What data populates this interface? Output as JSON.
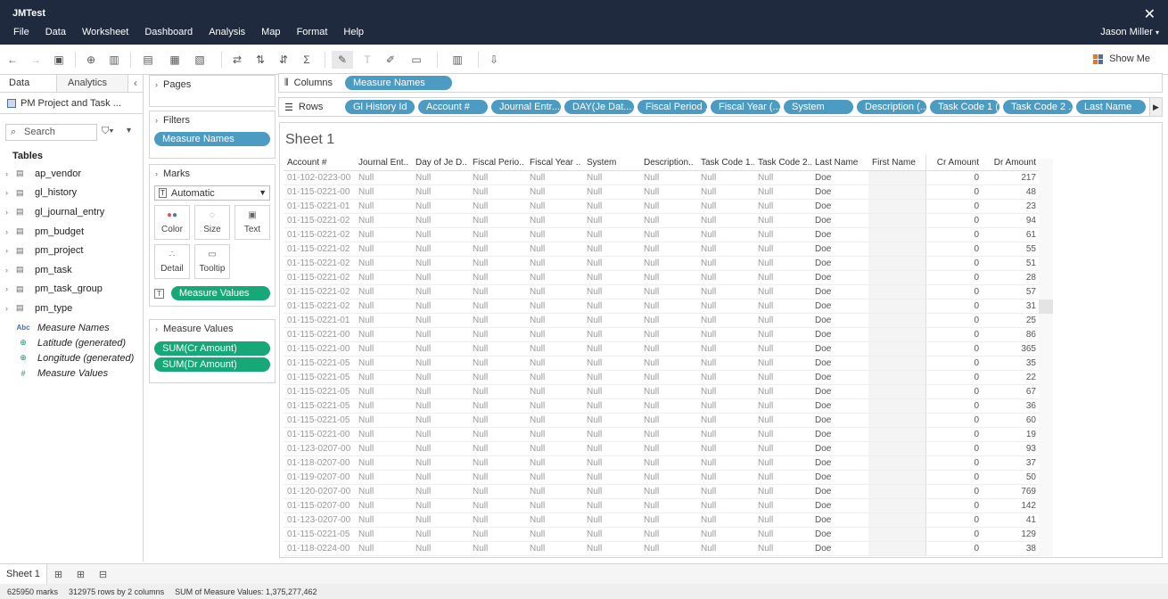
{
  "app": {
    "title": "JMTest",
    "user": "Jason Miller"
  },
  "menu": [
    "File",
    "Data",
    "Worksheet",
    "Dashboard",
    "Analysis",
    "Map",
    "Format",
    "Help"
  ],
  "toolbar": {
    "show_me": "Show Me"
  },
  "data_pane": {
    "tabs": [
      "Data",
      "Analytics"
    ],
    "datasource": "PM Project and Task ...",
    "search_placeholder": "Search",
    "tables_label": "Tables",
    "tables": [
      "ap_vendor",
      "gl_history",
      "gl_journal_entry",
      "pm_budget",
      "pm_project",
      "pm_task",
      "pm_task_group",
      "pm_type"
    ],
    "fields": [
      {
        "icon": "Abc",
        "name": "Measure Names"
      },
      {
        "icon": "⊕",
        "name": "Latitude (generated)"
      },
      {
        "icon": "⊕",
        "name": "Longitude (generated)"
      },
      {
        "icon": "#",
        "name": "Measure Values"
      }
    ]
  },
  "cards": {
    "pages": "Pages",
    "filters": "Filters",
    "filter_pill": "Measure Names",
    "marks": "Marks",
    "mark_type": "Automatic",
    "mark_buttons": [
      "Color",
      "Size",
      "Text",
      "Detail",
      "Tooltip"
    ],
    "marks_pill": "Measure Values",
    "measure_values": "Measure Values",
    "mv_pills": [
      "SUM(Cr Amount)",
      "SUM(Dr Amount)"
    ]
  },
  "shelves": {
    "columns_label": "Columns",
    "columns": [
      "Measure Names"
    ],
    "rows_label": "Rows",
    "rows": [
      "Gl History Id",
      "Account #",
      "Journal Entr...",
      "DAY(Je Dat...",
      "Fiscal Period ...",
      "Fiscal Year (...",
      "System",
      "Description (...",
      "Task Code 1 (...",
      "Task Code 2 ...",
      "Last Name"
    ]
  },
  "view": {
    "title": "Sheet 1",
    "headers": [
      "Account #",
      "Journal Ent..",
      "Day of Je D..",
      "Fiscal Perio..",
      "Fiscal Year ..",
      "System",
      "Description..",
      "Task Code 1..",
      "Task Code 2..",
      "Last Name",
      "First Name",
      "Cr Amount",
      "Dr Amount"
    ],
    "null_label": "Null",
    "last_name": "Doe",
    "rows": [
      {
        "acct": "01-102-0223-00",
        "cr": "0",
        "dr": "217"
      },
      {
        "acct": "01-115-0221-00",
        "cr": "0",
        "dr": "48"
      },
      {
        "acct": "01-115-0221-01",
        "cr": "0",
        "dr": "23"
      },
      {
        "acct": "01-115-0221-02",
        "cr": "0",
        "dr": "94"
      },
      {
        "acct": "01-115-0221-02",
        "cr": "0",
        "dr": "61"
      },
      {
        "acct": "01-115-0221-02",
        "cr": "0",
        "dr": "55"
      },
      {
        "acct": "01-115-0221-02",
        "cr": "0",
        "dr": "51"
      },
      {
        "acct": "01-115-0221-02",
        "cr": "0",
        "dr": "28"
      },
      {
        "acct": "01-115-0221-02",
        "cr": "0",
        "dr": "57"
      },
      {
        "acct": "01-115-0221-02",
        "cr": "0",
        "dr": "31"
      },
      {
        "acct": "01-115-0221-01",
        "cr": "0",
        "dr": "25"
      },
      {
        "acct": "01-115-0221-00",
        "cr": "0",
        "dr": "86"
      },
      {
        "acct": "01-115-0221-00",
        "cr": "0",
        "dr": "365"
      },
      {
        "acct": "01-115-0221-05",
        "cr": "0",
        "dr": "35"
      },
      {
        "acct": "01-115-0221-05",
        "cr": "0",
        "dr": "22"
      },
      {
        "acct": "01-115-0221-05",
        "cr": "0",
        "dr": "67"
      },
      {
        "acct": "01-115-0221-05",
        "cr": "0",
        "dr": "36"
      },
      {
        "acct": "01-115-0221-05",
        "cr": "0",
        "dr": "60"
      },
      {
        "acct": "01-115-0221-00",
        "cr": "0",
        "dr": "19"
      },
      {
        "acct": "01-123-0207-00",
        "cr": "0",
        "dr": "93"
      },
      {
        "acct": "01-118-0207-00",
        "cr": "0",
        "dr": "37"
      },
      {
        "acct": "01-119-0207-00",
        "cr": "0",
        "dr": "50"
      },
      {
        "acct": "01-120-0207-00",
        "cr": "0",
        "dr": "769"
      },
      {
        "acct": "01-115-0207-00",
        "cr": "0",
        "dr": "142"
      },
      {
        "acct": "01-123-0207-00",
        "cr": "0",
        "dr": "41"
      },
      {
        "acct": "01-115-0221-05",
        "cr": "0",
        "dr": "129"
      },
      {
        "acct": "01-118-0224-00",
        "cr": "0",
        "dr": "38"
      }
    ]
  },
  "sheet_tabs": [
    "Sheet 1"
  ],
  "status": [
    "625950 marks",
    "312975 rows by 2 columns",
    "SUM of Measure Values: 1,375,277,462"
  ],
  "colors": {
    "titlebar": "#1f2a3f",
    "pill_blue": "#4c9bc2",
    "pill_green": "#16a876"
  }
}
